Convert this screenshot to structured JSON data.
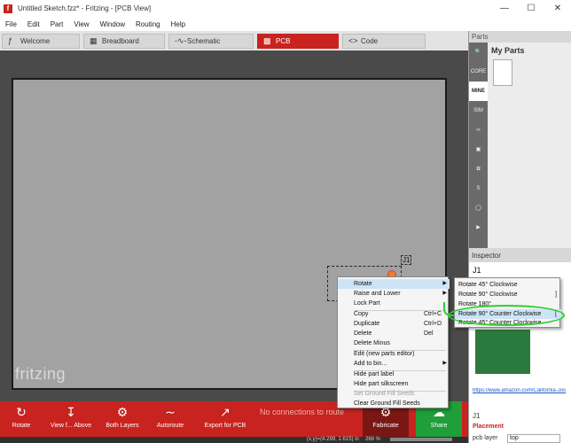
{
  "window": {
    "title": "Untitled Sketch.fzz* - Fritzing - [PCB View]",
    "app_icon": "f"
  },
  "menu": [
    "File",
    "Edit",
    "Part",
    "View",
    "Window",
    "Routing",
    "Help"
  ],
  "tabs": [
    {
      "label": "Welcome",
      "icon": "fritzing-icon",
      "active": false
    },
    {
      "label": "Breadboard",
      "icon": "breadboard-icon",
      "active": false
    },
    {
      "label": "Schematic",
      "icon": "schematic-icon",
      "active": false
    },
    {
      "label": "PCB",
      "icon": "pcb-icon",
      "active": true
    },
    {
      "label": "Code",
      "icon": "code-icon",
      "active": false
    }
  ],
  "canvas": {
    "logo_text": "fritzing",
    "part_label": "J1"
  },
  "toolbar": {
    "rotate": "Rotate",
    "view_from_above": "View f... Above",
    "both_layers": "Both Layers",
    "autoroute": "Autoroute",
    "export_for_pcb": "Export for PCB",
    "status_message": "No connections to route",
    "fabricate": "Fabricate",
    "share": "Share"
  },
  "statusbar": {
    "coords": "(x,y)=(4.299, 1.615) in",
    "zoom": "268 %"
  },
  "parts_panel": {
    "header": "Parts",
    "bin_title": "My Parts",
    "bins": [
      "search",
      "CORE",
      "MINE",
      "SIM",
      "arduino",
      "fritzing",
      "seeed",
      "sparkfun",
      "intel",
      "picaxe",
      "snootlab",
      "contrib"
    ]
  },
  "inspector": {
    "header": "Inspector",
    "title": "J1",
    "link": "https://www.amazon.com/California-Jos",
    "label_j1": "J1",
    "placement": "Placement",
    "pcb_layer_label": "pcb layer",
    "pcb_layer_value": "top"
  },
  "context_menu": {
    "rotate": "Rotate",
    "raise_lower": "Raise and Lower",
    "lock_part": "Lock Part",
    "copy": "Copy",
    "copy_shortcut": "Ctrl+C",
    "duplicate": "Duplicate",
    "duplicate_shortcut": "Ctrl+D",
    "delete": "Delete",
    "delete_shortcut": "Del",
    "delete_minus": "Delete Minus",
    "edit_new_parts_editor": "Edit (new parts editor)",
    "add_to_bin": "Add to bin...",
    "hide_part_label": "Hide part label",
    "hide_part_silkscreen": "Hide part silkscreen",
    "set_ground_fill_seeds": "Set Ground Fill Seeds",
    "clear_ground_fill_seeds": "Clear Ground Fill Seeds"
  },
  "rotate_submenu": {
    "rotate_45_cw": "Rotate 45° Clockwise",
    "rotate_90_cw": "Rotate 90° Clockwise",
    "rotate_90_cw_shortcut": "]",
    "rotate_180": "Rotate 180°",
    "rotate_90_ccw": "Rotate 90° Counter Clockwise",
    "rotate_90_ccw_shortcut": "[",
    "rotate_45_ccw": "Rotate 45° Counter Clockwise"
  },
  "colors": {
    "accent": "#c8231f",
    "share": "#1f9e3a",
    "annotation": "#2fcf2f"
  }
}
